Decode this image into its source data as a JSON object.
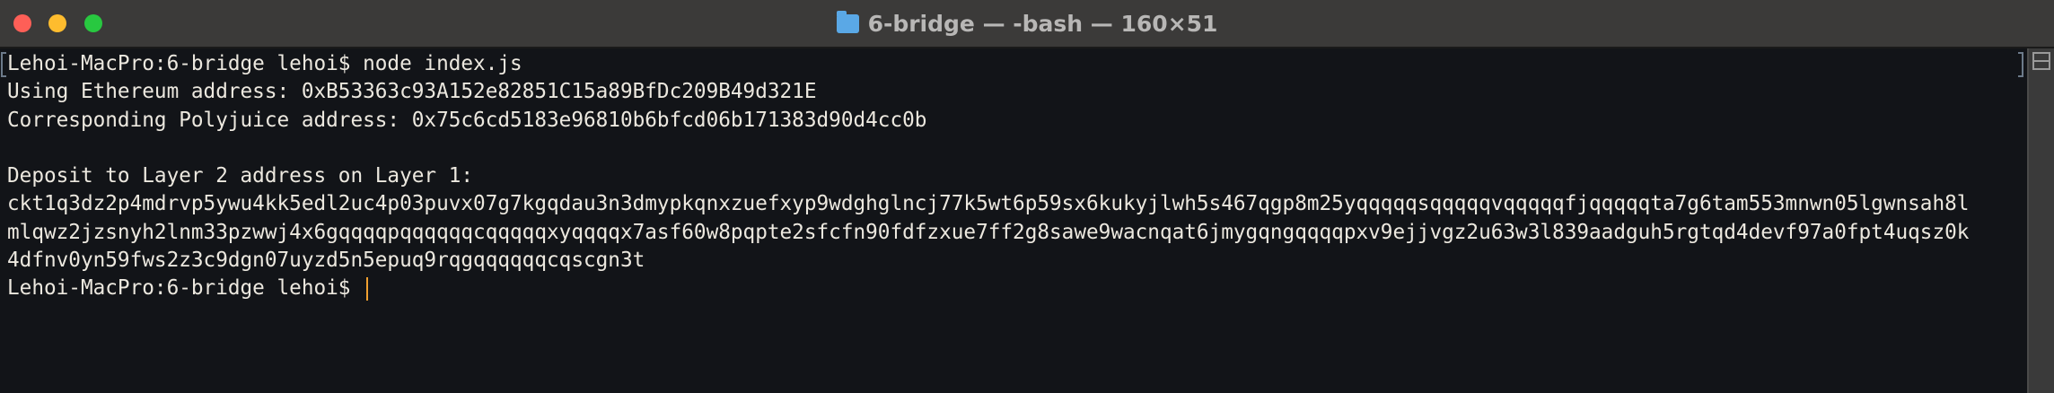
{
  "window": {
    "title": "6-bridge — -bash — 160×51",
    "icon": "folder-icon",
    "colors": {
      "close": "#fe5f57",
      "minimize": "#febc2e",
      "maximize": "#28c840",
      "background": "#121418",
      "text": "#ece8df",
      "cursor": "#f0a030"
    }
  },
  "terminal": {
    "lines": [
      "Lehoi-MacPro:6-bridge lehoi$ node index.js",
      "Using Ethereum address: 0xB53363c93A152e82851C15a89BfDc209B49d321E",
      "Corresponding Polyjuice address: 0x75c6cd5183e96810b6bfcd06b171383d90d4cc0b",
      "",
      "Deposit to Layer 2 address on Layer 1:",
      "ckt1q3dz2p4mdrvp5ywu4kk5edl2uc4p03puvx07g7kgqdau3n3dmypkqnxzuefxyp9wdghglncj77k5wt6p59sx6kukyjlwh5s467qgp8m25yqqqqqsqqqqqvqqqqqfjqqqqqta7g6tam553mnwn05lgwnsah8l",
      "mlqwz2jzsnyh2lnm33pzwwj4x6gqqqqpqqqqqqcqqqqqxyqqqqx7asf60w8pqpte2sfcfn90fdfzxue7ff2g8sawe9wacnqat6jmygqngqqqqpxv9ejjvgz2u63w3l839aadguh5rgtqd4devf97a0fpt4uqsz0k",
      "4dfnv0yn59fws2z3c9dgn07uyzd5n5epuq9rqgqqqqqqcqscgn3t"
    ],
    "prompt": "Lehoi-MacPro:6-bridge lehoi$ "
  }
}
